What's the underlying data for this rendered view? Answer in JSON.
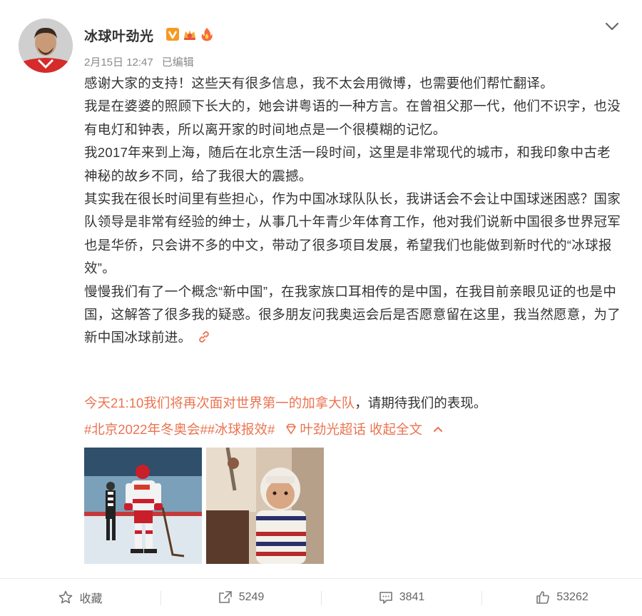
{
  "post": {
    "username": "冰球叶劲光",
    "date": "2月15日 12:47",
    "edited": "已编辑",
    "paragraphs": [
      "感谢大家的支持！这些天有很多信息，我不太会用微博，也需要他们帮忙翻译。",
      "我是在婆婆的照顾下长大的，她会讲粤语的一种方言。在曾祖父那一代，他们不识字，也没有电灯和钟表，所以离开家的时间地点是一个很模糊的记忆。",
      "我2017年来到上海，随后在北京生活一段时间，这里是非常现代的城市，和我印象中古老神秘的故乡不同，给了我很大的震撼。",
      "其实我在很长时间里有些担心，作为中国冰球队队长，我讲话会不会让中国球迷困惑？国家队领导是非常有经验的绅士，从事几十年青少年体育工作，他对我们说新中国很多世界冠军也是华侨，只会讲不多的中文，带动了很多项目发展，希望我们也能做到新时代的“冰球报效”。",
      "慢慢我们有了一个概念“新中国”，在我家族口耳相传的是中国，在我目前亲眼见证的也是中国，这解答了很多我的疑惑。很多朋友问我奥运会后是否愿意留在这里，我当然愿意，为了新中国冰球前进。"
    ],
    "highlight": "今天21:10我们将再次面对世界第一的加拿大队",
    "highlight_tail": "，请期待我们的表现。",
    "tag1": "#北京2022年冬奥会#",
    "tag2": "#冰球报效#",
    "supertopic": "叶劲光超话",
    "collapse": "收起全文"
  },
  "actions": {
    "favorite": "收藏",
    "repost": "5249",
    "comment": "3841",
    "like": "53262"
  },
  "colors": {
    "accent": "#eb7350",
    "text": "#333333",
    "meta": "#8a8a8a",
    "verified": "#f59a23"
  },
  "icons": [
    "verified-v-icon",
    "fan-crown-icon",
    "flame-icon",
    "chevron-down-icon",
    "link-icon",
    "supertopic-diamond-icon",
    "collapse-up-icon",
    "star-icon",
    "share-icon",
    "comment-icon",
    "thumbs-up-icon"
  ]
}
